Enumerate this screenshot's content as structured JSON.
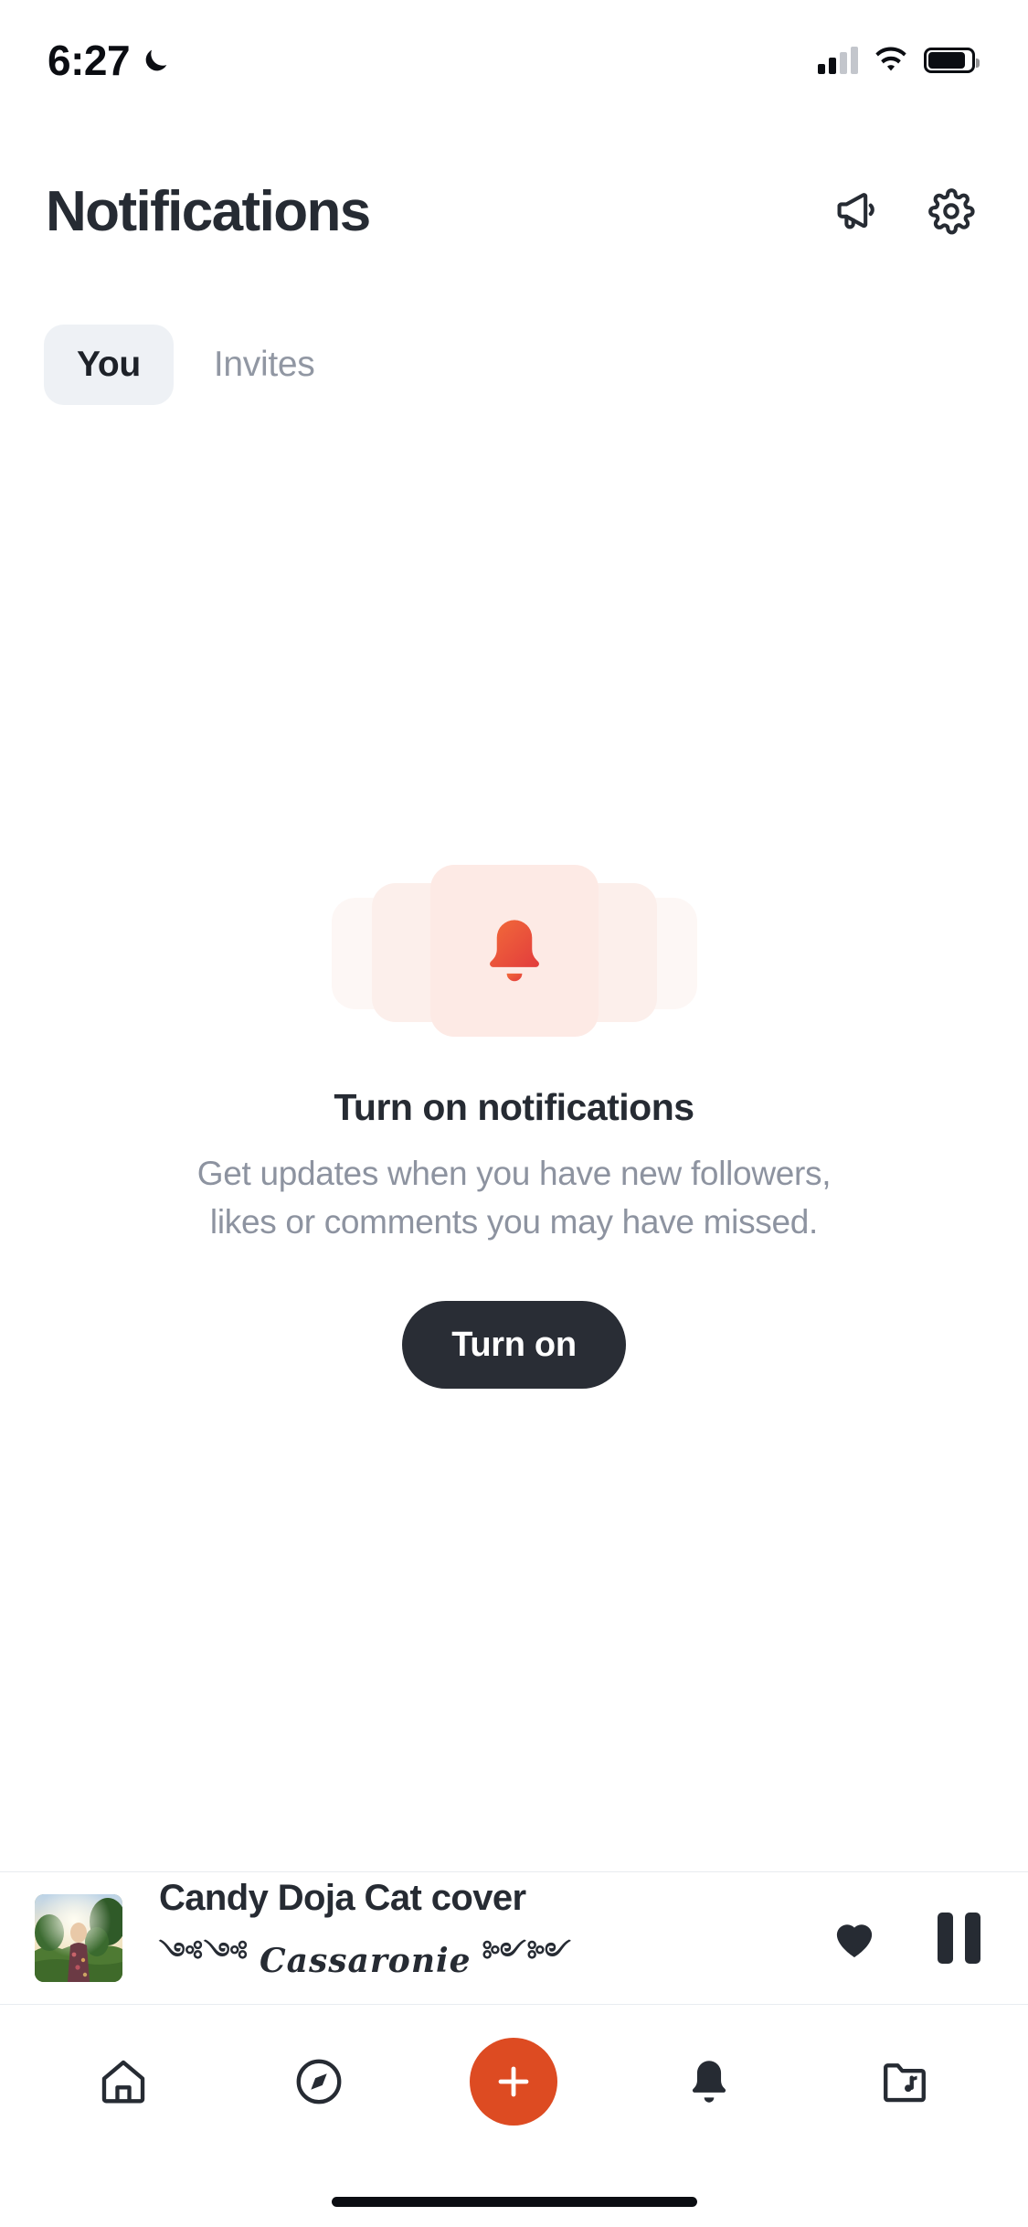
{
  "status_bar": {
    "time": "6:27",
    "dnd_icon": "crescent-moon-icon",
    "cellular_icon": "cellular-signal-icon",
    "wifi_icon": "wifi-icon",
    "battery_icon": "battery-icon",
    "battery_level_pct": 88
  },
  "header": {
    "title": "Notifications",
    "announce_icon": "megaphone-icon",
    "settings_icon": "gear-icon"
  },
  "tabs": [
    {
      "label": "You",
      "active": true,
      "name": "tab-you"
    },
    {
      "label": "Invites",
      "active": false,
      "name": "tab-invites"
    }
  ],
  "empty_state": {
    "illustration_icon": "bell-icon",
    "title": "Turn on notifications",
    "subtitle_line1": "Get updates when you have new followers,",
    "subtitle_line2": "likes or comments you may have missed.",
    "button_label": "Turn on"
  },
  "player": {
    "artwork_alt": "album-artwork",
    "track_title": "Candy Doja Cat cover",
    "artist_name": "Cassaronie",
    "ornament_left": "༺༺",
    "ornament_right": "༻༻",
    "like_icon": "heart-filled-icon",
    "playback_icon": "pause-icon",
    "is_playing": true,
    "is_liked": true
  },
  "bottom_nav": [
    {
      "name": "nav-home",
      "icon": "home-icon",
      "active": false
    },
    {
      "name": "nav-discover",
      "icon": "compass-icon",
      "active": false
    },
    {
      "name": "nav-create",
      "icon": "plus-icon",
      "active": false
    },
    {
      "name": "nav-activity",
      "icon": "bell-filled-icon",
      "active": true
    },
    {
      "name": "nav-library",
      "icon": "music-folder-icon",
      "active": false
    }
  ],
  "colors": {
    "accent": "#dd4b22",
    "text_primary": "#262b33",
    "text_secondary": "#8d93a0",
    "tab_active_bg": "#eef1f5",
    "button_dark": "#292d35",
    "illustration_pink": "#fdeae5",
    "divider": "#e9ecf0"
  }
}
